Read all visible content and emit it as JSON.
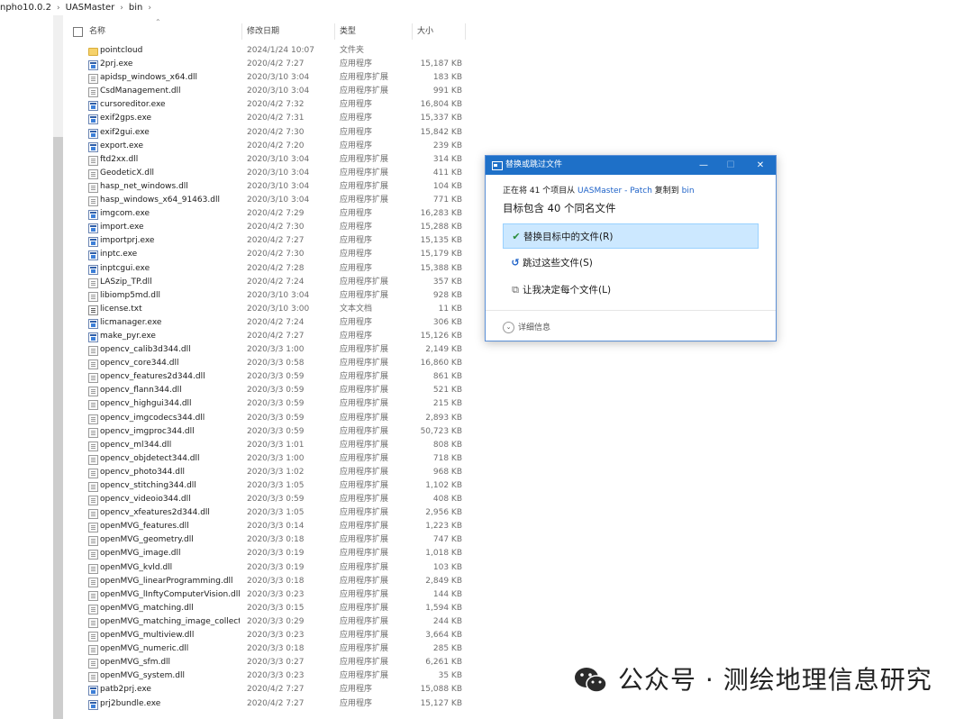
{
  "breadcrumb": [
    "npho10.0.2",
    "UASMaster",
    "bin"
  ],
  "columns": {
    "name": "名称",
    "date": "修改日期",
    "type": "类型",
    "size": "大小"
  },
  "files": [
    {
      "name": "pointcloud",
      "date": "2024/1/24 10:07",
      "type": "文件夹",
      "size": "",
      "icon": "folder-icon"
    },
    {
      "name": "2prj.exe",
      "date": "2020/4/2 7:27",
      "type": "应用程序",
      "size": "15,187 KB",
      "icon": "exe-icon"
    },
    {
      "name": "apidsp_windows_x64.dll",
      "date": "2020/3/10 3:04",
      "type": "应用程序扩展",
      "size": "183 KB",
      "icon": "dll-icon"
    },
    {
      "name": "CsdManagement.dll",
      "date": "2020/3/10 3:04",
      "type": "应用程序扩展",
      "size": "991 KB",
      "icon": "dll-icon"
    },
    {
      "name": "cursoreditor.exe",
      "date": "2020/4/2 7:32",
      "type": "应用程序",
      "size": "16,804 KB",
      "icon": "exe-icon"
    },
    {
      "name": "exif2gps.exe",
      "date": "2020/4/2 7:31",
      "type": "应用程序",
      "size": "15,337 KB",
      "icon": "exe-icon"
    },
    {
      "name": "exif2gui.exe",
      "date": "2020/4/2 7:30",
      "type": "应用程序",
      "size": "15,842 KB",
      "icon": "exe-icon"
    },
    {
      "name": "export.exe",
      "date": "2020/4/2 7:20",
      "type": "应用程序",
      "size": "239 KB",
      "icon": "exe-icon"
    },
    {
      "name": "ftd2xx.dll",
      "date": "2020/3/10 3:04",
      "type": "应用程序扩展",
      "size": "314 KB",
      "icon": "dll-icon"
    },
    {
      "name": "GeodeticX.dll",
      "date": "2020/3/10 3:04",
      "type": "应用程序扩展",
      "size": "411 KB",
      "icon": "dll-icon"
    },
    {
      "name": "hasp_net_windows.dll",
      "date": "2020/3/10 3:04",
      "type": "应用程序扩展",
      "size": "104 KB",
      "icon": "dll-icon"
    },
    {
      "name": "hasp_windows_x64_91463.dll",
      "date": "2020/3/10 3:04",
      "type": "应用程序扩展",
      "size": "771 KB",
      "icon": "dll-icon"
    },
    {
      "name": "imgcom.exe",
      "date": "2020/4/2 7:29",
      "type": "应用程序",
      "size": "16,283 KB",
      "icon": "exe-icon"
    },
    {
      "name": "import.exe",
      "date": "2020/4/2 7:30",
      "type": "应用程序",
      "size": "15,288 KB",
      "icon": "exe-icon"
    },
    {
      "name": "importprj.exe",
      "date": "2020/4/2 7:27",
      "type": "应用程序",
      "size": "15,135 KB",
      "icon": "exe-icon"
    },
    {
      "name": "inptc.exe",
      "date": "2020/4/2 7:30",
      "type": "应用程序",
      "size": "15,179 KB",
      "icon": "exe-icon"
    },
    {
      "name": "inptcgui.exe",
      "date": "2020/4/2 7:28",
      "type": "应用程序",
      "size": "15,388 KB",
      "icon": "exe-icon"
    },
    {
      "name": "LASzip_TP.dll",
      "date": "2020/4/2 7:24",
      "type": "应用程序扩展",
      "size": "357 KB",
      "icon": "dll-icon"
    },
    {
      "name": "libiomp5md.dll",
      "date": "2020/3/10 3:04",
      "type": "应用程序扩展",
      "size": "928 KB",
      "icon": "dll-icon"
    },
    {
      "name": "license.txt",
      "date": "2020/3/10 3:00",
      "type": "文本文档",
      "size": "11 KB",
      "icon": "text-file-icon"
    },
    {
      "name": "licmanager.exe",
      "date": "2020/4/2 7:24",
      "type": "应用程序",
      "size": "306 KB",
      "icon": "exe-icon"
    },
    {
      "name": "make_pyr.exe",
      "date": "2020/4/2 7:27",
      "type": "应用程序",
      "size": "15,126 KB",
      "icon": "exe-icon"
    },
    {
      "name": "opencv_calib3d344.dll",
      "date": "2020/3/3 1:00",
      "type": "应用程序扩展",
      "size": "2,149 KB",
      "icon": "dll-icon"
    },
    {
      "name": "opencv_core344.dll",
      "date": "2020/3/3 0:58",
      "type": "应用程序扩展",
      "size": "16,860 KB",
      "icon": "dll-icon"
    },
    {
      "name": "opencv_features2d344.dll",
      "date": "2020/3/3 0:59",
      "type": "应用程序扩展",
      "size": "861 KB",
      "icon": "dll-icon"
    },
    {
      "name": "opencv_flann344.dll",
      "date": "2020/3/3 0:59",
      "type": "应用程序扩展",
      "size": "521 KB",
      "icon": "dll-icon"
    },
    {
      "name": "opencv_highgui344.dll",
      "date": "2020/3/3 0:59",
      "type": "应用程序扩展",
      "size": "215 KB",
      "icon": "dll-icon"
    },
    {
      "name": "opencv_imgcodecs344.dll",
      "date": "2020/3/3 0:59",
      "type": "应用程序扩展",
      "size": "2,893 KB",
      "icon": "dll-icon"
    },
    {
      "name": "opencv_imgproc344.dll",
      "date": "2020/3/3 0:59",
      "type": "应用程序扩展",
      "size": "50,723 KB",
      "icon": "dll-icon"
    },
    {
      "name": "opencv_ml344.dll",
      "date": "2020/3/3 1:01",
      "type": "应用程序扩展",
      "size": "808 KB",
      "icon": "dll-icon"
    },
    {
      "name": "opencv_objdetect344.dll",
      "date": "2020/3/3 1:00",
      "type": "应用程序扩展",
      "size": "718 KB",
      "icon": "dll-icon"
    },
    {
      "name": "opencv_photo344.dll",
      "date": "2020/3/3 1:02",
      "type": "应用程序扩展",
      "size": "968 KB",
      "icon": "dll-icon"
    },
    {
      "name": "opencv_stitching344.dll",
      "date": "2020/3/3 1:05",
      "type": "应用程序扩展",
      "size": "1,102 KB",
      "icon": "dll-icon"
    },
    {
      "name": "opencv_videoio344.dll",
      "date": "2020/3/3 0:59",
      "type": "应用程序扩展",
      "size": "408 KB",
      "icon": "dll-icon"
    },
    {
      "name": "opencv_xfeatures2d344.dll",
      "date": "2020/3/3 1:05",
      "type": "应用程序扩展",
      "size": "2,956 KB",
      "icon": "dll-icon"
    },
    {
      "name": "openMVG_features.dll",
      "date": "2020/3/3 0:14",
      "type": "应用程序扩展",
      "size": "1,223 KB",
      "icon": "dll-icon"
    },
    {
      "name": "openMVG_geometry.dll",
      "date": "2020/3/3 0:18",
      "type": "应用程序扩展",
      "size": "747 KB",
      "icon": "dll-icon"
    },
    {
      "name": "openMVG_image.dll",
      "date": "2020/3/3 0:19",
      "type": "应用程序扩展",
      "size": "1,018 KB",
      "icon": "dll-icon"
    },
    {
      "name": "openMVG_kvld.dll",
      "date": "2020/3/3 0:19",
      "type": "应用程序扩展",
      "size": "103 KB",
      "icon": "dll-icon"
    },
    {
      "name": "openMVG_linearProgramming.dll",
      "date": "2020/3/3 0:18",
      "type": "应用程序扩展",
      "size": "2,849 KB",
      "icon": "dll-icon"
    },
    {
      "name": "openMVG_lInftyComputerVision.dll",
      "date": "2020/3/3 0:23",
      "type": "应用程序扩展",
      "size": "144 KB",
      "icon": "dll-icon"
    },
    {
      "name": "openMVG_matching.dll",
      "date": "2020/3/3 0:15",
      "type": "应用程序扩展",
      "size": "1,594 KB",
      "icon": "dll-icon"
    },
    {
      "name": "openMVG_matching_image_collect...",
      "date": "2020/3/3 0:29",
      "type": "应用程序扩展",
      "size": "244 KB",
      "icon": "dll-icon"
    },
    {
      "name": "openMVG_multiview.dll",
      "date": "2020/3/3 0:23",
      "type": "应用程序扩展",
      "size": "3,664 KB",
      "icon": "dll-icon"
    },
    {
      "name": "openMVG_numeric.dll",
      "date": "2020/3/3 0:18",
      "type": "应用程序扩展",
      "size": "285 KB",
      "icon": "dll-icon"
    },
    {
      "name": "openMVG_sfm.dll",
      "date": "2020/3/3 0:27",
      "type": "应用程序扩展",
      "size": "6,261 KB",
      "icon": "dll-icon"
    },
    {
      "name": "openMVG_system.dll",
      "date": "2020/3/3 0:23",
      "type": "应用程序扩展",
      "size": "35 KB",
      "icon": "dll-icon"
    },
    {
      "name": "patb2prj.exe",
      "date": "2020/4/2 7:27",
      "type": "应用程序",
      "size": "15,088 KB",
      "icon": "exe-icon"
    },
    {
      "name": "prj2bundle.exe",
      "date": "2020/4/2 7:27",
      "type": "应用程序",
      "size": "15,127 KB",
      "icon": "exe-icon"
    }
  ],
  "dialog": {
    "title": "替换或跳过文件",
    "line1_prefix": "正在将 41 个项目从 ",
    "source": "UASMaster - Patch",
    "line1_middle": " 复制到 ",
    "destination": "bin",
    "message": "目标包含 40 个同名文件",
    "options": [
      {
        "label": "替换目标中的文件(R)",
        "icon": "checkmark-icon",
        "selected": true
      },
      {
        "label": "跳过这些文件(S)",
        "icon": "skip-arrow-icon",
        "selected": false
      },
      {
        "label": "让我决定每个文件(L)",
        "icon": "decide-files-icon",
        "selected": false
      }
    ],
    "details": "详细信息"
  },
  "watermark": {
    "text": "公众号 · 测绘地理信息研究"
  },
  "colors": {
    "titlebar": "#1e70c8",
    "selected_option": "#cce8ff",
    "link": "#1e62c8"
  }
}
